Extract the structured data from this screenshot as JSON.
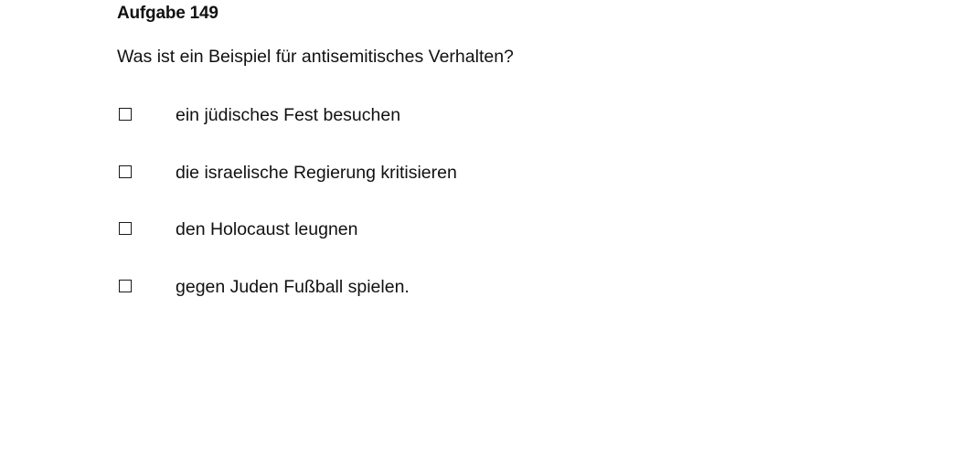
{
  "task": {
    "title": "Aufgabe 149",
    "question": "Was ist ein Beispiel für antisemitisches Verhalten?",
    "options": [
      {
        "label": "ein jüdisches Fest besuchen",
        "checked": false
      },
      {
        "label": "die israelische Regierung kritisieren",
        "checked": false
      },
      {
        "label": "den Holocaust leugnen",
        "checked": false
      },
      {
        "label": "gegen Juden Fußball spielen.",
        "checked": false
      }
    ]
  }
}
